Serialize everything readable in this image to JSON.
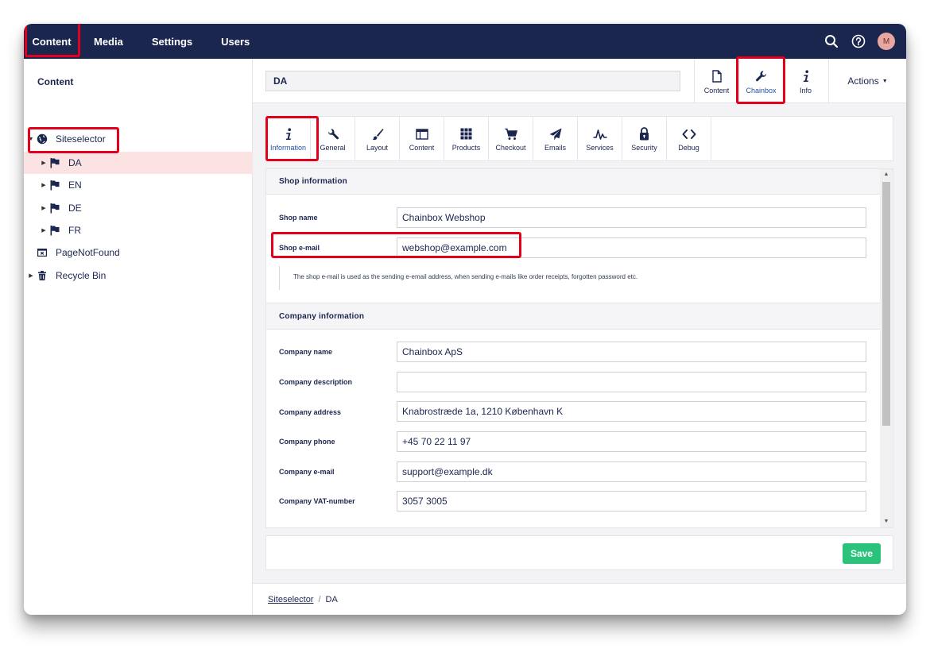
{
  "topnav": {
    "items": [
      {
        "label": "Content",
        "active": true
      },
      {
        "label": "Media"
      },
      {
        "label": "Settings"
      },
      {
        "label": "Users"
      }
    ],
    "icons": [
      "search-icon",
      "help-icon"
    ],
    "avatar_initial": "M"
  },
  "tree": {
    "title": "Content",
    "items": [
      {
        "label": "Siteselector",
        "icon": "globe-icon"
      },
      {
        "label": "DA",
        "icon": "flag-icon",
        "selected": true
      },
      {
        "label": "EN",
        "icon": "flag-icon"
      },
      {
        "label": "DE",
        "icon": "flag-icon"
      },
      {
        "label": "FR",
        "icon": "flag-icon"
      },
      {
        "label": "PageNotFound",
        "icon": "error-page-icon"
      },
      {
        "label": "Recycle Bin",
        "icon": "trash-icon"
      }
    ]
  },
  "header": {
    "node_name": "DA",
    "apps": [
      {
        "label": "Content",
        "icon": "document-icon"
      },
      {
        "label": "Chainbox",
        "icon": "wrench-icon",
        "active": true
      },
      {
        "label": "Info",
        "icon": "info-icon"
      }
    ],
    "actions_label": "Actions"
  },
  "subtabs": [
    {
      "label": "Information",
      "icon": "info-icon",
      "active": true
    },
    {
      "label": "General",
      "icon": "wrench-icon"
    },
    {
      "label": "Layout",
      "icon": "brush-icon"
    },
    {
      "label": "Content",
      "icon": "window-icon"
    },
    {
      "label": "Products",
      "icon": "grid-icon"
    },
    {
      "label": "Checkout",
      "icon": "cart-icon"
    },
    {
      "label": "Emails",
      "icon": "paper-plane-icon"
    },
    {
      "label": "Services",
      "icon": "pulse-icon"
    },
    {
      "label": "Security",
      "icon": "lock-icon"
    },
    {
      "label": "Debug",
      "icon": "code-icon"
    }
  ],
  "form": {
    "shop_section": "Shop information",
    "shop_name": {
      "label": "Shop name",
      "value": "Chainbox Webshop"
    },
    "shop_email": {
      "label": "Shop e-mail",
      "value": "webshop@example.com"
    },
    "shop_email_hint": "The shop e-mail is used as the sending e-email address, when sending e-mails like order receipts, forgotten password etc.",
    "company_section": "Company information",
    "company_name": {
      "label": "Company name",
      "value": "Chainbox ApS"
    },
    "company_description": {
      "label": "Company description",
      "value": ""
    },
    "company_address": {
      "label": "Company address",
      "value": "Knabrostræde 1a, 1210 København K"
    },
    "company_phone": {
      "label": "Company phone",
      "value": "+45 70 22 11 97"
    },
    "company_email": {
      "label": "Company e-mail",
      "value": "support@example.dk"
    },
    "company_vat": {
      "label": "Company VAT-number",
      "value": "3057 3005"
    }
  },
  "save_label": "Save",
  "breadcrumb": {
    "root": "Siteselector",
    "separator": "/",
    "current": "DA"
  },
  "colors": {
    "topbar": "#1b264f",
    "highlight": "#e3001b",
    "save": "#2bc37c",
    "selected_row": "#fbe3e3"
  }
}
